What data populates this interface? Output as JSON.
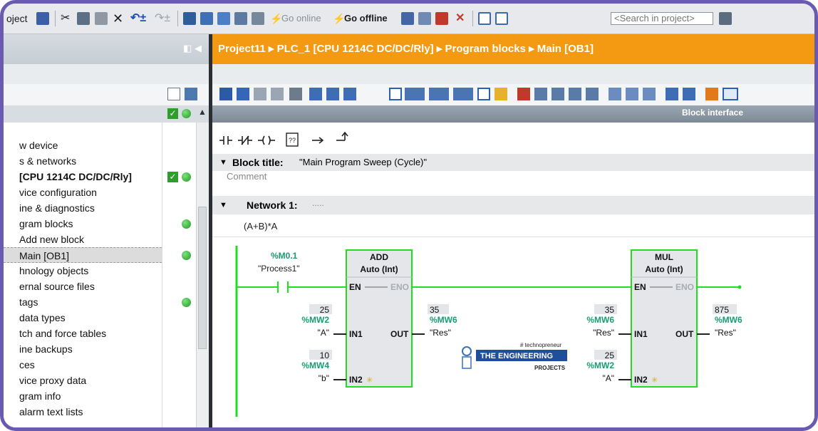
{
  "toolbar": {
    "project_label": "oject",
    "go_online": "Go online",
    "go_offline": "Go offline",
    "search_placeholder": "<Search in project>"
  },
  "breadcrumb": [
    "Project11",
    "PLC_1 [CPU 1214C DC/DC/Rly]",
    "Program blocks",
    "Main [OB1]"
  ],
  "block_interface_label": "Block interface",
  "tree": [
    {
      "label": "w device",
      "status": ""
    },
    {
      "label": "s & networks",
      "status": ""
    },
    {
      "label": "[CPU 1214C DC/DC/Rly]",
      "status": "check-dot",
      "bold": true
    },
    {
      "label": "vice configuration",
      "status": ""
    },
    {
      "label": "ine & diagnostics",
      "status": ""
    },
    {
      "label": "gram blocks",
      "status": "dot"
    },
    {
      "label": "Add new block",
      "status": ""
    },
    {
      "label": "Main [OB1]",
      "status": "dot",
      "selected": true
    },
    {
      "label": "hnology objects",
      "status": ""
    },
    {
      "label": "ernal source files",
      "status": ""
    },
    {
      "label": "tags",
      "status": "dot"
    },
    {
      "label": "data types",
      "status": ""
    },
    {
      "label": "tch and force tables",
      "status": ""
    },
    {
      "label": "ine backups",
      "status": ""
    },
    {
      "label": "ces",
      "status": ""
    },
    {
      "label": "vice proxy data",
      "status": ""
    },
    {
      "label": "gram info",
      "status": ""
    },
    {
      "label": "alarm text lists",
      "status": ""
    }
  ],
  "block": {
    "title_label": "Block title:",
    "title_value": "\"Main Program Sweep (Cycle)\"",
    "comment": "Comment"
  },
  "network": {
    "label": "Network 1:",
    "dots": ".....",
    "comment": "(A+B)*A"
  },
  "ladder": {
    "contact_addr": "%M0.1",
    "contact_name": "\"Process1\"",
    "add": {
      "name": "ADD",
      "type": "Auto (Int)",
      "en": "EN",
      "eno": "ENO",
      "in1": "IN1",
      "in2": "IN2",
      "out": "OUT",
      "in1_value": "25",
      "in1_addr": "%MW2",
      "in1_tag": "\"A\"",
      "in2_value": "10",
      "in2_addr": "%MW4",
      "in2_tag": "\"b\"",
      "out_value": "35",
      "out_addr": "%MW6",
      "out_tag": "\"Res\""
    },
    "mul": {
      "name": "MUL",
      "type": "Auto (Int)",
      "en": "EN",
      "eno": "ENO",
      "in1": "IN1",
      "in2": "IN2",
      "out": "OUT",
      "in1_value": "35",
      "in1_addr": "%MW6",
      "in1_tag": "\"Res\"",
      "in2_value": "25",
      "in2_addr": "%MW2",
      "in2_tag": "\"A\"",
      "out_value": "875",
      "out_addr": "%MW6",
      "out_tag": "\"Res\""
    }
  },
  "watermark": {
    "tag": "# technopreneur",
    "brand": "THE ENGINEERING",
    "sub": "PROJECTS"
  },
  "colors": {
    "accent": "#f39a12",
    "frame": "#6a5ab0",
    "power_flow": "#22dd22",
    "address": "#1a9c72"
  }
}
